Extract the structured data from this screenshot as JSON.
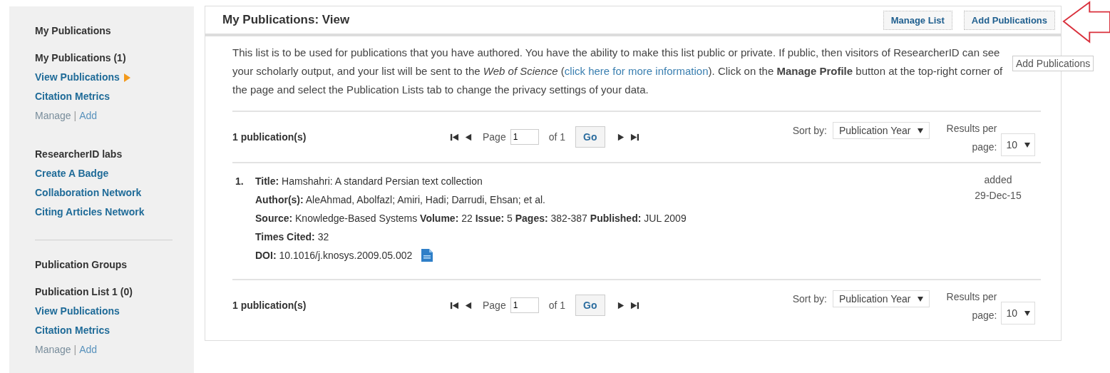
{
  "sidebar": {
    "blocks": [
      {
        "kind": "title",
        "text": "My Publications"
      },
      {
        "kind": "group",
        "label": "My Publications (1)",
        "links": [
          {
            "text": "View Publications",
            "selected": true
          },
          {
            "text": "Citation Metrics",
            "selected": false
          }
        ],
        "actions": [
          "Manage",
          "Add"
        ],
        "separator": "|"
      },
      {
        "kind": "group",
        "label": "ResearcherID labs",
        "links": [
          {
            "text": "Create A Badge",
            "selected": false
          },
          {
            "text": "Collaboration Network",
            "selected": false
          },
          {
            "text": "Citing Articles Network",
            "selected": false
          }
        ]
      },
      {
        "kind": "divider"
      },
      {
        "kind": "title",
        "text": "Publication Groups"
      },
      {
        "kind": "group",
        "label": "Publication List 1 (0)",
        "links": [
          {
            "text": "View Publications",
            "selected": false
          },
          {
            "text": "Citation Metrics",
            "selected": false
          }
        ],
        "actions": [
          "Manage",
          "Add"
        ],
        "separator": "|"
      }
    ]
  },
  "main": {
    "title": "My Publications: View",
    "buttons": [
      "Manage List",
      "Add Publications"
    ],
    "tooltip": "Add Publications",
    "intro": [
      {
        "kind": "text",
        "text": "This list is to be used for publications that you have authored. You have the ability to make this list public or private. If public, then visitors of ResearcherID can see your scholarly output, and your list will be sent to the *Web of Science* ("
      },
      {
        "kind": "link",
        "text": "click here for more information"
      },
      {
        "kind": "text",
        "text": "). Click on the **Manage Profile** button at the top-right corner of the page and select the Publication Lists tab to change the privacy settings of your data."
      }
    ],
    "pagers": [
      {
        "count": "1 publication(s)",
        "page_label": "Page",
        "page_value": "1",
        "of": "of 1",
        "go": "Go",
        "sort_label": "Sort by:",
        "sort_value": "Publication Year",
        "per_page_label": "Results per page:",
        "per_page_value": "10"
      },
      {
        "count": "1 publication(s)",
        "page_label": "Page",
        "page_value": "1",
        "of": "of 1",
        "go": "Go",
        "sort_label": "Sort by:",
        "sort_value": "Publication Year",
        "per_page_label": "Results per page:",
        "per_page_value": "10"
      }
    ],
    "publications": [
      {
        "number": "1.",
        "lines": [
          "**Title:** Hamshahri: A standard Persian text collection",
          "**Author(s):** AleAhmad, Abolfazl; Amiri, Hadi; Darrudi, Ehsan; et al.",
          "**Source:** Knowledge-Based Systems **Volume:** 22 **Issue:** 5 **Pages:** 382-387 **Published:** JUL 2009",
          "**Times Cited:** 32",
          "**DOI:** 10.1016/j.knosys.2009.05.002"
        ],
        "full_text": true,
        "added_label": "added",
        "added_date": "29-Dec-15"
      }
    ]
  }
}
